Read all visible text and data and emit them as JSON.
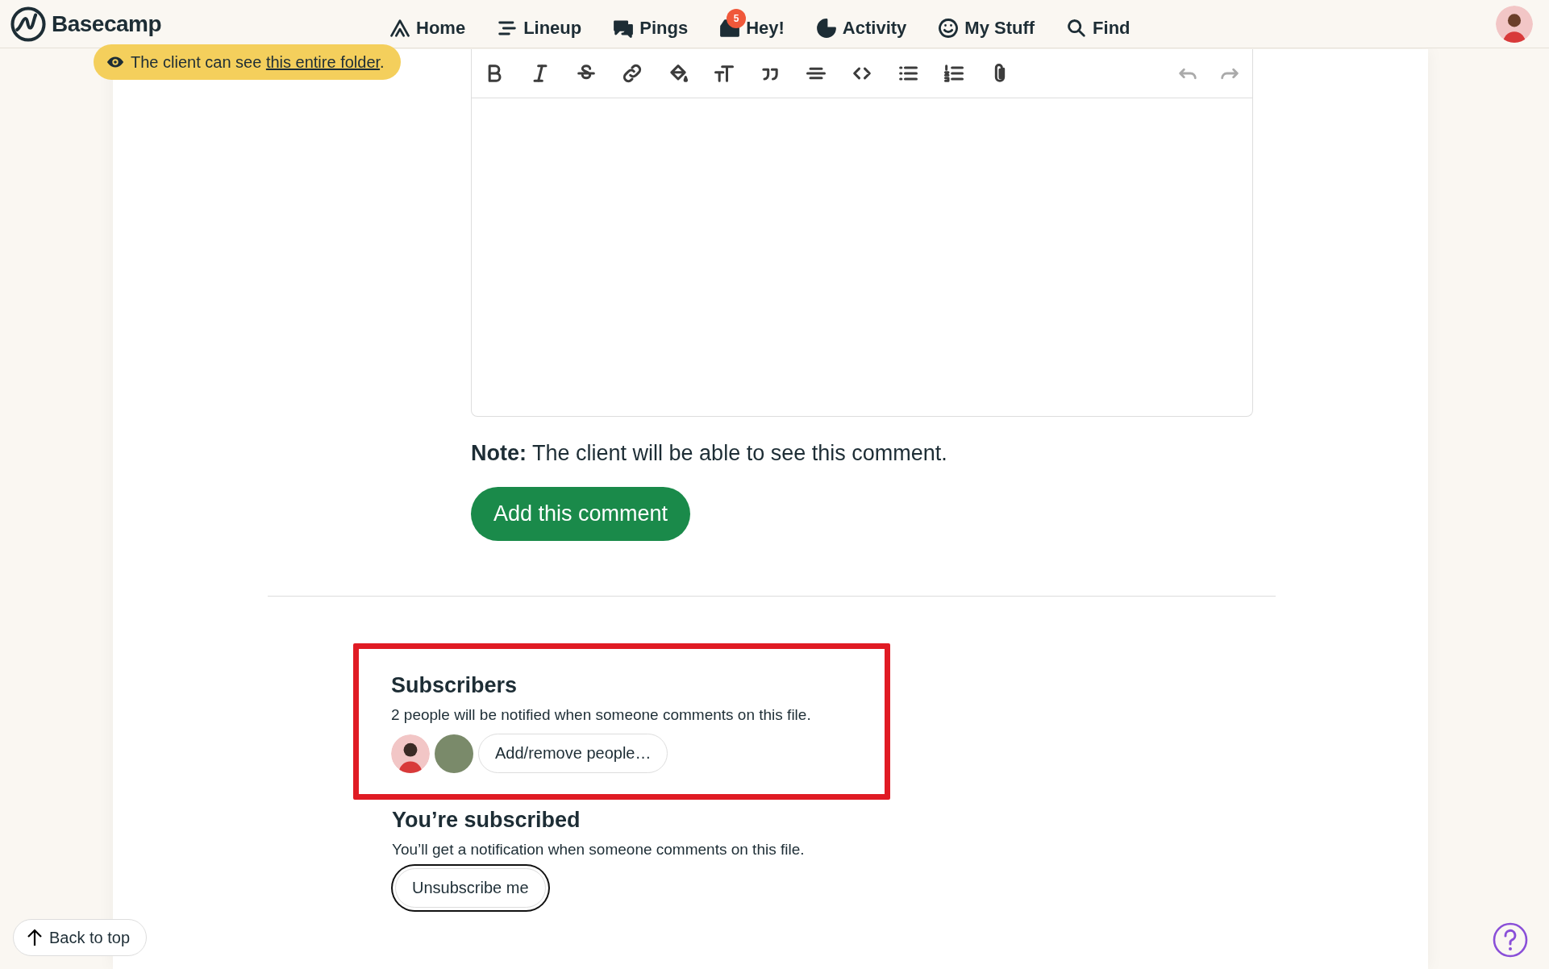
{
  "brand": {
    "name": "Basecamp"
  },
  "nav": [
    {
      "kind": "home",
      "label": "Home"
    },
    {
      "kind": "lineup",
      "label": "Lineup"
    },
    {
      "kind": "pings",
      "label": "Pings"
    },
    {
      "kind": "hey",
      "label": "Hey!",
      "badge": "5"
    },
    {
      "kind": "activity",
      "label": "Activity"
    },
    {
      "kind": "mystuff",
      "label": "My Stuff"
    },
    {
      "kind": "find",
      "label": "Find"
    }
  ],
  "client_banner": {
    "text": "The client can see ",
    "link": "this entire folder",
    "end": "."
  },
  "toolbar": [
    {
      "kind": "bold",
      "disabled": false
    },
    {
      "kind": "italic",
      "disabled": false
    },
    {
      "kind": "strike",
      "disabled": false
    },
    {
      "kind": "link",
      "disabled": false
    },
    {
      "kind": "color",
      "disabled": false
    },
    {
      "kind": "size",
      "disabled": false
    },
    {
      "kind": "quote",
      "disabled": false
    },
    {
      "kind": "divider",
      "disabled": false
    },
    {
      "kind": "code",
      "disabled": false
    },
    {
      "kind": "bullets",
      "disabled": false
    },
    {
      "kind": "numbers",
      "disabled": false
    },
    {
      "kind": "attach",
      "disabled": false
    },
    {
      "kind": "undo",
      "disabled": true
    },
    {
      "kind": "redo",
      "disabled": true
    }
  ],
  "note": "**Note:** The client will be able to see this comment.",
  "submit_button": "Add this comment",
  "subscribers": {
    "title": "Subscribers",
    "text": "2 people will be notified when someone comments on this file.",
    "people": [
      {
        "kind": "illustration"
      },
      {
        "kind": "photo"
      }
    ],
    "button": "Add/remove people…"
  },
  "subscription": {
    "title": "You’re subscribed",
    "text": "You’ll get a notification when someone comments on this file.",
    "button": "Unsubscribe me"
  },
  "back_to_top": "Back to top"
}
